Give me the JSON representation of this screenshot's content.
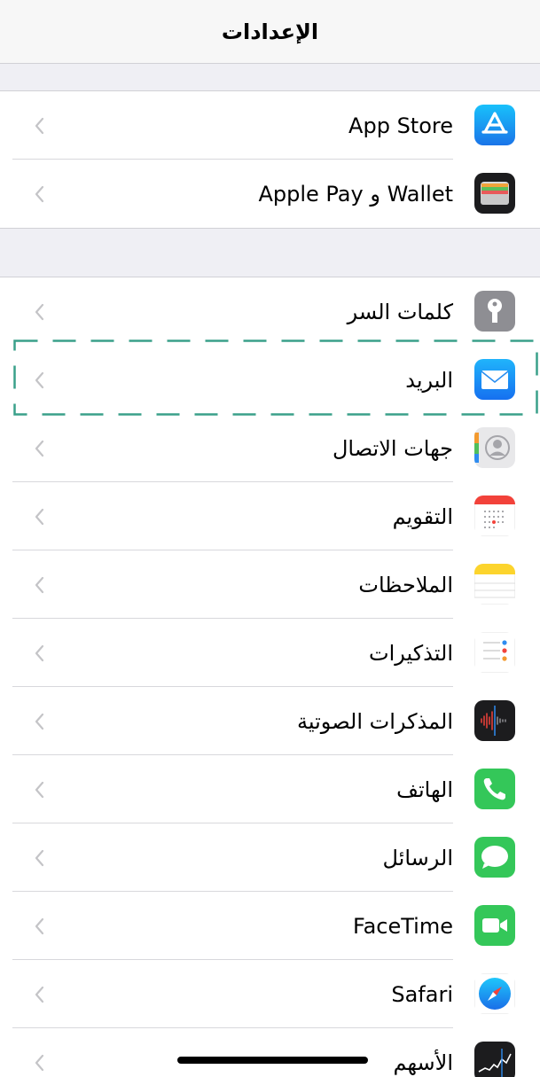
{
  "header": {
    "title": "الإعدادات"
  },
  "settings": {
    "group1": [
      {
        "label": "App Store",
        "icon": "app-store-icon"
      },
      {
        "label": "Wallet و Apple Pay",
        "icon": "wallet-icon"
      }
    ],
    "group2": [
      {
        "label": "كلمات السر",
        "icon": "key-icon"
      },
      {
        "label": "البريد",
        "icon": "mail-icon"
      },
      {
        "label": "جهات الاتصال",
        "icon": "contacts-icon"
      },
      {
        "label": "التقويم",
        "icon": "calendar-icon"
      },
      {
        "label": "الملاحظات",
        "icon": "notes-icon"
      },
      {
        "label": "التذكيرات",
        "icon": "reminders-icon"
      },
      {
        "label": "المذكرات الصوتية",
        "icon": "voice-memos-icon"
      },
      {
        "label": "الهاتف",
        "icon": "phone-icon"
      },
      {
        "label": "الرسائل",
        "icon": "messages-icon"
      },
      {
        "label": "FaceTime",
        "icon": "facetime-icon"
      },
      {
        "label": "Safari",
        "icon": "safari-icon"
      },
      {
        "label": "الأسهم",
        "icon": "stocks-icon"
      }
    ]
  },
  "colors": {
    "selection_border": "#3aa08a",
    "chevron": "#c4c4c7",
    "app_store": "#1a8cf0",
    "mail": "#1f8ff5",
    "phone": "#34c759",
    "messages": "#34c759",
    "facetime": "#34c759"
  }
}
